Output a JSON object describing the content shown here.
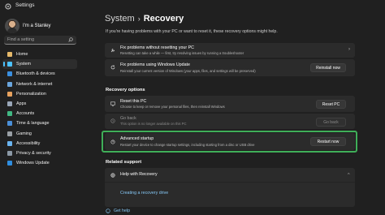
{
  "window": {
    "title": "Settings"
  },
  "sidebar": {
    "user_name": "I'm a Stanley",
    "search_placeholder": "Find a setting",
    "items": [
      {
        "label": "Home",
        "icon": "home-icon",
        "color": "#e6b96a",
        "active": false
      },
      {
        "label": "System",
        "icon": "system-icon",
        "color": "#4cc2ff",
        "active": true
      },
      {
        "label": "Bluetooth & devices",
        "icon": "bluetooth-icon",
        "color": "#3a8fe0",
        "active": false
      },
      {
        "label": "Network & internet",
        "icon": "network-icon",
        "color": "#6aa6de",
        "active": false
      },
      {
        "label": "Personalization",
        "icon": "brush-icon",
        "color": "#e8a25e",
        "active": false
      },
      {
        "label": "Apps",
        "icon": "apps-icon",
        "color": "#9aa7b8",
        "active": false
      },
      {
        "label": "Accounts",
        "icon": "accounts-icon",
        "color": "#41b883",
        "active": false
      },
      {
        "label": "Time & language",
        "icon": "globe-clock-icon",
        "color": "#4a90d9",
        "active": false
      },
      {
        "label": "Gaming",
        "icon": "gaming-icon",
        "color": "#9aa0a6",
        "active": false
      },
      {
        "label": "Accessibility",
        "icon": "accessibility-icon",
        "color": "#6ab4f0",
        "active": false
      },
      {
        "label": "Privacy & security",
        "icon": "shield-icon",
        "color": "#8c99a6",
        "active": false
      },
      {
        "label": "Windows Update",
        "icon": "windows-update-icon",
        "color": "#2f8ee0",
        "active": false
      }
    ]
  },
  "main": {
    "breadcrumb_parent": "System",
    "breadcrumb_separator": "›",
    "page_title": "Recovery",
    "intro": "If you're having problems with your PC or want to reset it, these recovery options might help.",
    "fix_without_reset": {
      "title": "Fix problems without resetting your PC",
      "desc": "Resetting can take a while — first, try resolving issues by running a troubleshooter"
    },
    "fix_windows_update": {
      "title": "Fix problems using Windows Update",
      "desc": "Reinstall your current version of Windows (your apps, files, and settings will be preserved)",
      "button": "Reinstall now"
    },
    "recovery_options_title": "Recovery options",
    "reset_pc": {
      "title": "Reset this PC",
      "desc": "Choose to keep or remove your personal files, then reinstall Windows",
      "button": "Reset PC"
    },
    "go_back": {
      "title": "Go back",
      "desc": "This option is no longer available on this PC",
      "button": "Go back"
    },
    "advanced_startup": {
      "title": "Advanced startup",
      "desc": "Restart your device to change startup settings, including starting from a disc or USB drive",
      "button": "Restart now"
    },
    "related_support_title": "Related support",
    "help_with_recovery": "Help with Recovery",
    "create_recovery_drive": "Creating a recovery drive",
    "get_help": "Get help"
  }
}
